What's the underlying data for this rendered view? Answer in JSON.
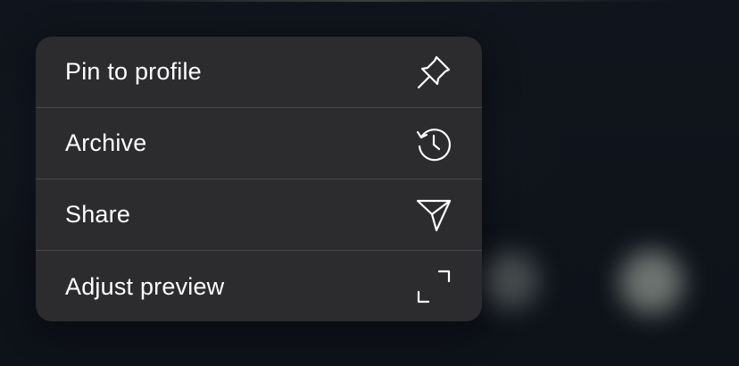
{
  "context_menu": {
    "items": [
      {
        "label": "Pin to profile",
        "icon": "pin-icon"
      },
      {
        "label": "Archive",
        "icon": "archive-clock-icon"
      },
      {
        "label": "Share",
        "icon": "send-icon"
      },
      {
        "label": "Adjust preview",
        "icon": "expand-corners-icon"
      }
    ]
  },
  "colors": {
    "menu_background": "#2c2c2e",
    "divider": "#48484c",
    "text": "#ffffff",
    "backdrop": "#0f131b"
  }
}
